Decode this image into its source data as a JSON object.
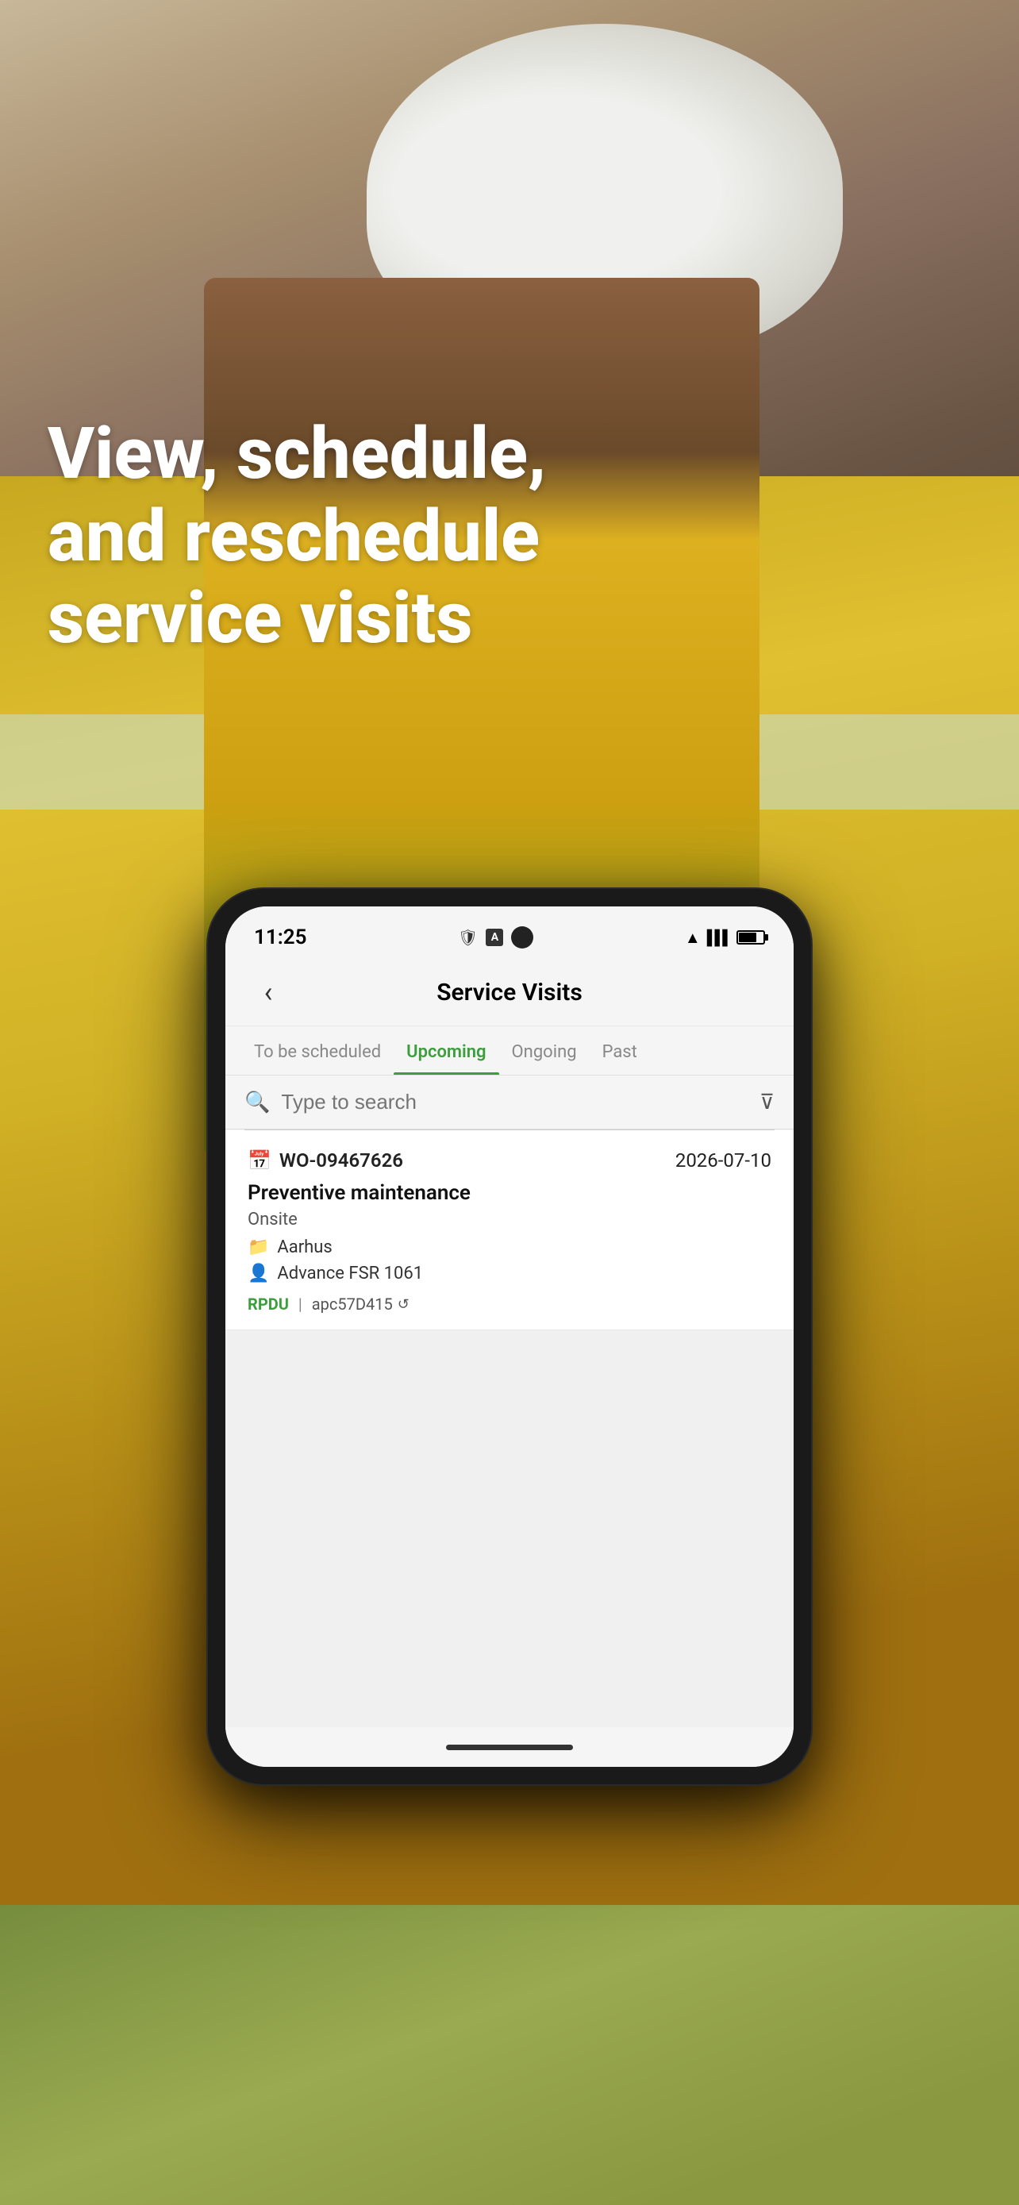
{
  "background": {
    "alt": "Worker in yellow safety jacket and white hard hat"
  },
  "hero": {
    "text": "View, schedule, and reschedule service visits"
  },
  "phone": {
    "status_bar": {
      "time": "11:25",
      "camera_dot": true
    },
    "app": {
      "title": "Service Visits",
      "back_label": "←",
      "tabs": [
        {
          "id": "to-be-scheduled",
          "label": "To be scheduled",
          "active": false
        },
        {
          "id": "upcoming",
          "label": "Upcoming",
          "active": true
        },
        {
          "id": "ongoing",
          "label": "Ongoing",
          "active": false
        },
        {
          "id": "past",
          "label": "Past",
          "active": false
        }
      ],
      "search": {
        "placeholder": "Type to search"
      },
      "visits": [
        {
          "wo_number": "WO-09467626",
          "date": "2026-07-10",
          "type": "Preventive maintenance",
          "mode": "Onsite",
          "location": "Aarhus",
          "engineer": "Advance FSR 1061",
          "tag_primary": "RPDU",
          "tag_asset": "apc57D415",
          "tag_icon": "↺"
        }
      ]
    }
  },
  "colors": {
    "accent_green": "#3d9e3d",
    "tab_active": "#3d9e3d",
    "text_primary": "#111",
    "text_secondary": "#555",
    "bg_screen": "#f5f5f5"
  }
}
